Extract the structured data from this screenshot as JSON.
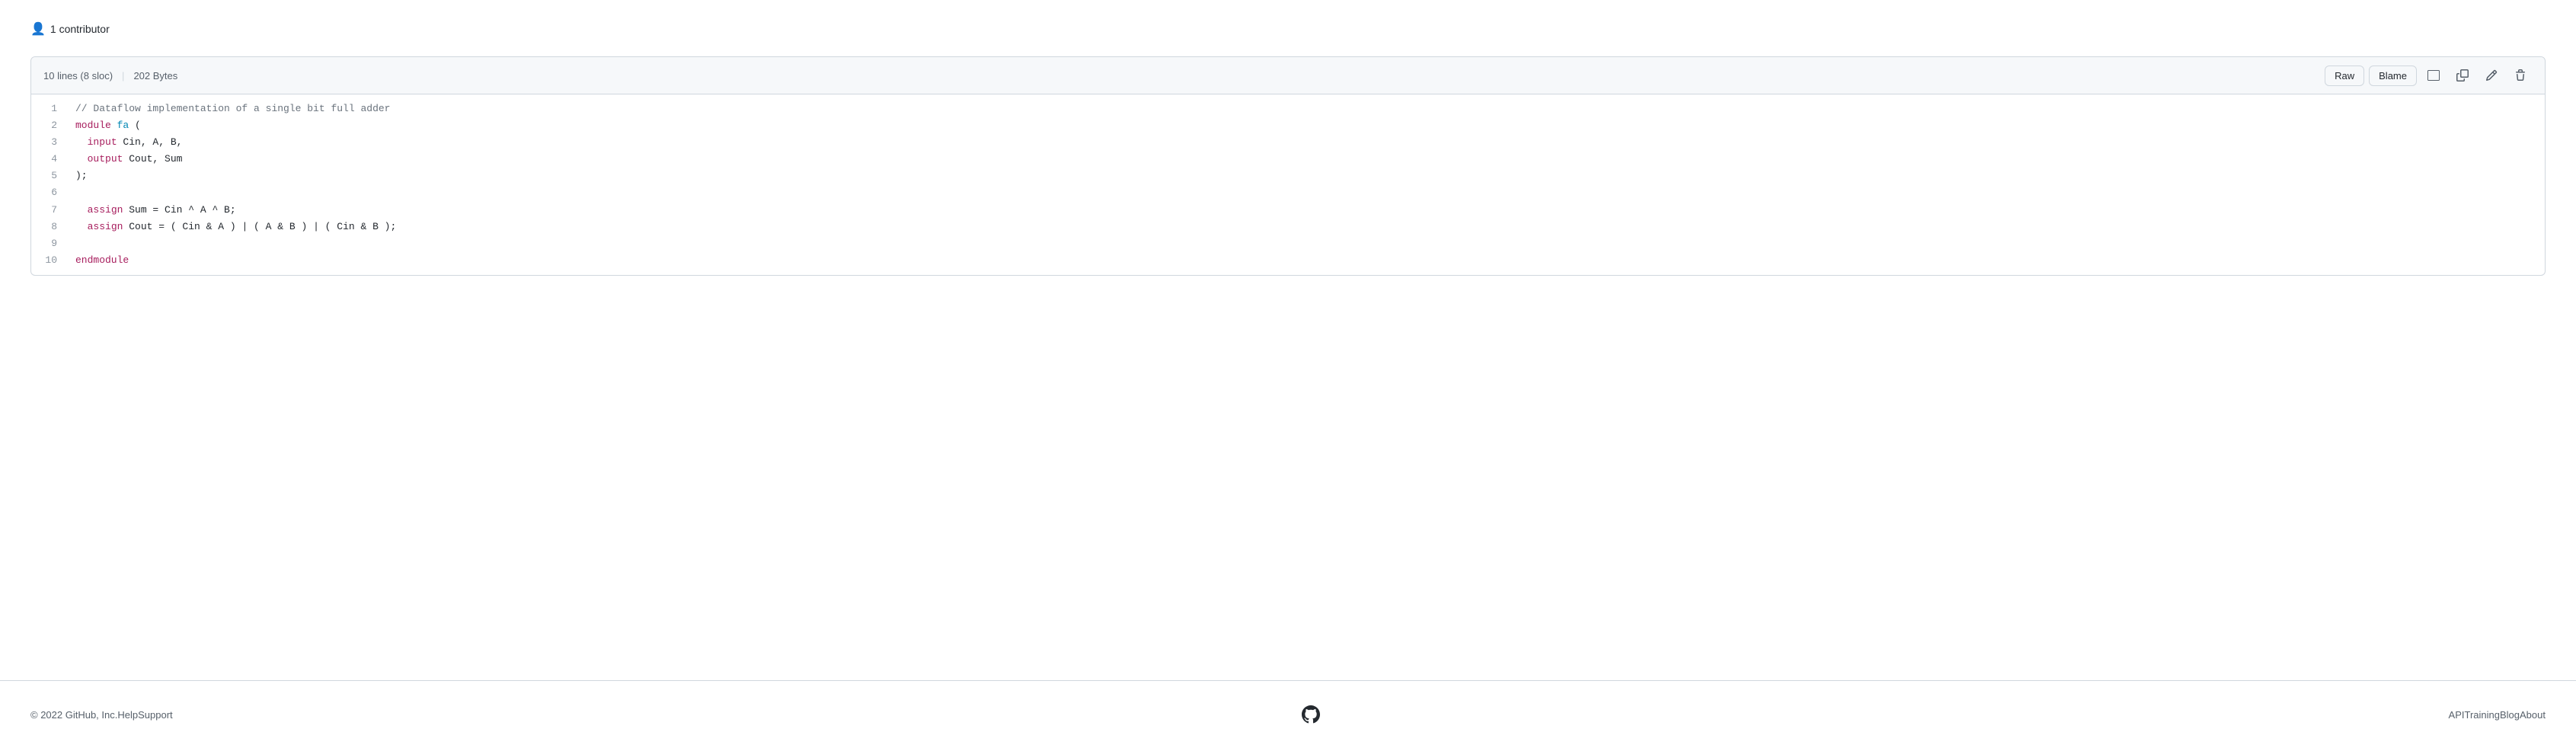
{
  "contributor_bar": {
    "icon": "👤",
    "text": "1 contributor"
  },
  "file_header": {
    "lines_label": "10 lines (8 sloc)",
    "size_label": "202 Bytes",
    "raw_button": "Raw",
    "blame_button": "Blame",
    "display_icon": "⬜",
    "copy_icon": "📋",
    "edit_icon": "✏️",
    "delete_icon": "🗑️"
  },
  "code_lines": [
    {
      "number": 1,
      "content": "// Dataflow implementation of a single bit full adder",
      "type": "comment"
    },
    {
      "number": 2,
      "content": "module fa (",
      "type": "module"
    },
    {
      "number": 3,
      "content": "  input Cin, A, B,",
      "type": "input"
    },
    {
      "number": 4,
      "content": "  output Cout, Sum",
      "type": "output"
    },
    {
      "number": 5,
      "content": ");",
      "type": "plain"
    },
    {
      "number": 6,
      "content": "",
      "type": "plain"
    },
    {
      "number": 7,
      "content": "  assign Sum = Cin ^ A ^ B;",
      "type": "assign"
    },
    {
      "number": 8,
      "content": "  assign Cout = ( Cin & A ) | ( A & B ) | ( Cin & B );",
      "type": "assign"
    },
    {
      "number": 9,
      "content": "",
      "type": "plain"
    },
    {
      "number": 10,
      "content": "endmodule",
      "type": "endmodule"
    }
  ],
  "footer": {
    "copyright": "© 2022 GitHub, Inc.",
    "links": [
      {
        "label": "Help",
        "href": "#"
      },
      {
        "label": "Support",
        "href": "#"
      },
      {
        "label": "API",
        "href": "#"
      },
      {
        "label": "Training",
        "href": "#"
      },
      {
        "label": "Blog",
        "href": "#"
      },
      {
        "label": "About",
        "href": "#"
      }
    ]
  }
}
